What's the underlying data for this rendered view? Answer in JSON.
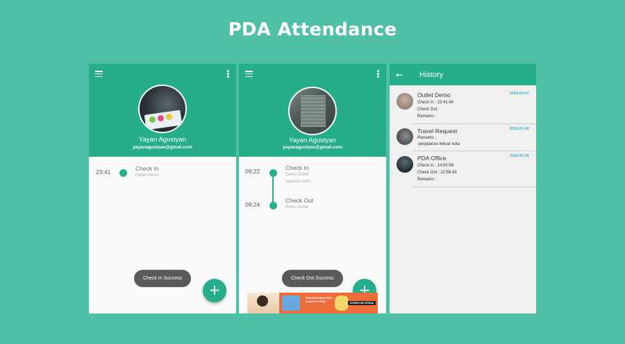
{
  "page_title": "PDA Attendance",
  "colors": {
    "background": "#4fbfa5",
    "primary": "#26ae8a",
    "date": "#3fb0c8",
    "toast": "#5a5a5a"
  },
  "screen1": {
    "profile": {
      "name": "Yayan Agustyan",
      "email": "yayanagustyan@gmail.com"
    },
    "events": [
      {
        "time": "23:41",
        "title": "Check In",
        "location": "Outlet Demo"
      }
    ],
    "toast": "Check In Success",
    "fab": "+"
  },
  "screen2": {
    "profile": {
      "name": "Yayan Agustyan",
      "email": "yayanagustyan@gmail.com"
    },
    "events": [
      {
        "time": "09:22",
        "title": "Check In",
        "location": "Demo Outlet",
        "note": "optional notes"
      },
      {
        "time": "09:24",
        "title": "Check Out",
        "location": "Demo Outlet"
      }
    ],
    "toast": "Check Out Success",
    "fab": "+",
    "ad": {
      "text": "PERLENGKAPAN BAYI & ANAK PILIHAN",
      "button": "DOWNLOAD NOW ▶"
    }
  },
  "history": {
    "title": "History",
    "items": [
      {
        "name": "Outlet Demo",
        "date": "2018-03-07",
        "lines": [
          "Check In    : 23:41:46",
          "Check Out :",
          "Remarks :"
        ]
      },
      {
        "name": "Travel Request",
        "date": "2018-03-06",
        "lines": [
          "Remarks :",
          "-perjalanan keluar kota"
        ]
      },
      {
        "name": "PDA Office",
        "date": "2018-02-25",
        "lines": [
          "Check In    : 14:00:56",
          "Check Out : 22:58:43",
          "Remarks :"
        ]
      }
    ]
  }
}
